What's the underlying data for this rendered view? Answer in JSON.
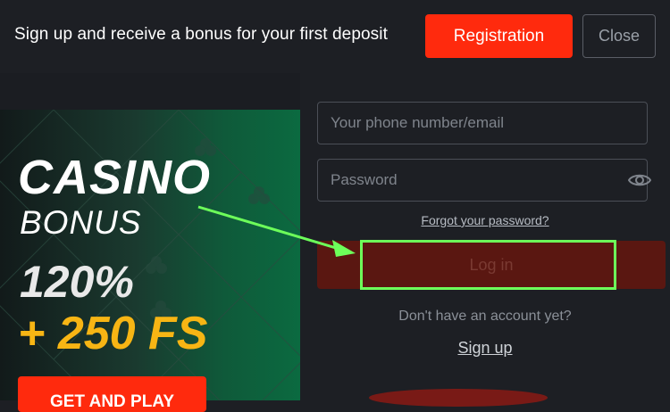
{
  "topbar": {
    "message": "Sign up and receive a bonus for your first deposit",
    "registration_label": "Registration",
    "close_label": "Close"
  },
  "banner": {
    "line1": "CASINO",
    "line2": "BONUS",
    "line3": "120%",
    "line4": "+ 250 FS",
    "cta_label": "GET AND PLAY"
  },
  "login_form": {
    "phone_placeholder": "Your phone number/email",
    "password_placeholder": "Password",
    "forgot_label": "Forgot your password?",
    "login_label": "Log in",
    "no_account_label": "Don't have an account yet?",
    "signup_label": "Sign up"
  },
  "icons": {
    "password_toggle": "eye-icon"
  },
  "colors": {
    "accent": "#ff2a0d",
    "highlight": "#6dff5a",
    "bonus_yellow": "#f7b514",
    "login_disabled": "#5a1711"
  }
}
